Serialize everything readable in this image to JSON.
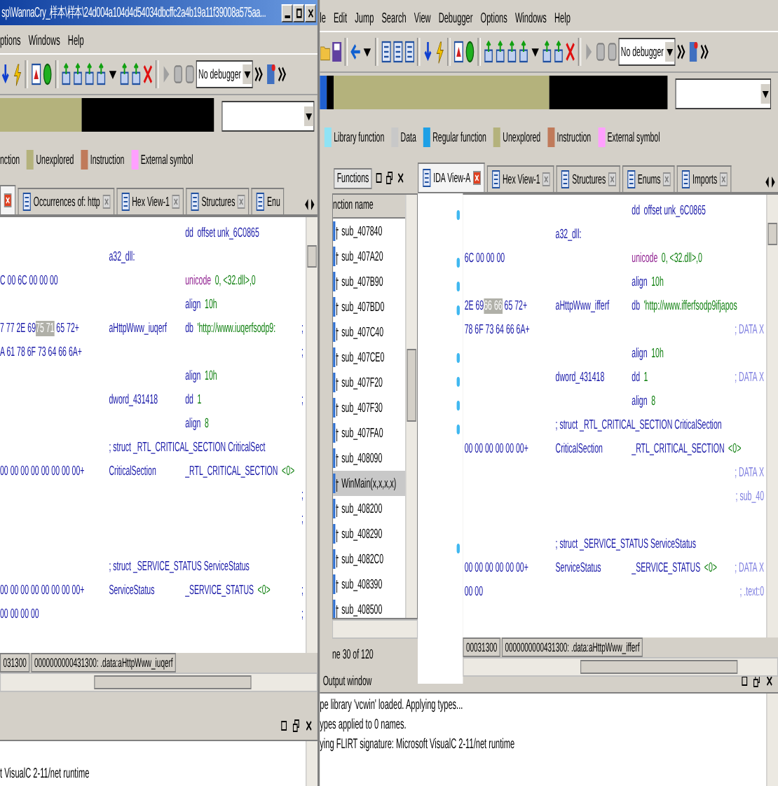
{
  "left_window": {
    "title": "sp\\WannaCry_样本\\样本\\24d004a104d4d54034dbcffc2a4b19a11f39008a575aa...",
    "menu": [
      "ptions",
      "Windows",
      "Help"
    ],
    "debugger": "No debugger",
    "legend": [
      {
        "label": "nction"
      },
      {
        "label": "Unexplored",
        "color": "#b4b27c"
      },
      {
        "label": "Instruction",
        "color": "#c07a5a"
      },
      {
        "label": "External symbol",
        "color": "#ffa0ff"
      }
    ],
    "tabs": [
      {
        "selected": true
      },
      {
        "label": "Occurrences of: http",
        "selected": false
      },
      {
        "label": "Hex View-1",
        "selected": false
      },
      {
        "label": "Structures",
        "selected": false
      },
      {
        "label": "Enu",
        "selected": false
      }
    ],
    "listing": [
      {
        "mnemonic": "dd",
        "operand": "offset unk_6C0865",
        "kind": "ref"
      },
      {
        "label": "a32_dll:",
        "kind": "plain"
      },
      {
        "bytes": "C 00 6C 00 00 00",
        "mnemonic": "unicode",
        "operand": "0, <32.dll>,0",
        "kind": "unicode"
      },
      {
        "mnemonic": "align",
        "operand": "10h",
        "kind": "data"
      },
      {
        "bytes": "7 77 2E 69",
        "bytes_hl": "75 71",
        "bytes_post": "65 72+",
        "label": "aHttpWww_iuqerf",
        "mnemonic": "db",
        "operand": "'http://www.iuqerfsodp9:",
        "comment": ";",
        "kind": "data"
      },
      {
        "bytes": "A 61 78 6F 73 64 66 6A+",
        "comment": ";",
        "kind": "plain"
      },
      {
        "mnemonic": "align",
        "operand": "10h",
        "kind": "data"
      },
      {
        "label": "dword_431418",
        "mnemonic": "dd",
        "operand": "1",
        "comment": ";",
        "kind": "data"
      },
      {
        "mnemonic": "align",
        "operand": "8",
        "kind": "data"
      },
      {
        "mnemonic": "; struct _RTL_CRITICAL_SECTION CriticalSect",
        "kind": "struct"
      },
      {
        "bytes": "00 00 00 00 00 00 00 00+",
        "label": "CriticalSection",
        "mnemonic": "_RTL_CRITICAL_SECTION",
        "operand": "<0>",
        "kind": "struct_var"
      },
      {
        "comment": ";",
        "kind": "plain"
      },
      {
        "comment": ";",
        "kind": "plain"
      },
      {
        "kind": "blank"
      },
      {
        "mnemonic": "; struct _SERVICE_STATUS ServiceStatus",
        "kind": "struct"
      },
      {
        "bytes": "00 00 00 00 00 00 00 00+",
        "label": "ServiceStatus",
        "mnemonic": "_SERVICE_STATUS",
        "operand": "<0>",
        "comment": ";",
        "kind": "struct_var"
      },
      {
        "bytes": "00 00 00 00",
        "comment": ";",
        "kind": "plain"
      }
    ],
    "status": [
      "031300",
      "0000000000431300: .data:aHttpWww_iuqerf"
    ],
    "output": [
      "t VisualC 2-11/net runtime"
    ]
  },
  "right_window": {
    "menu": [
      "le",
      "Edit",
      "Jump",
      "Search",
      "View",
      "Debugger",
      "Options",
      "Windows",
      "Help"
    ],
    "debugger": "No debugger",
    "legend": [
      {
        "label": "Library function",
        "color": "#8fe3f5"
      },
      {
        "label": "Data",
        "color": "#c8c8c8"
      },
      {
        "label": "Regular function",
        "color": "#1ea0e6"
      },
      {
        "label": "Unexplored",
        "color": "#b4b27c"
      },
      {
        "label": "Instruction",
        "color": "#c07a5a"
      },
      {
        "label": "External symbol",
        "color": "#ffa0ff"
      }
    ],
    "functions": {
      "title": "Functions",
      "column": "nction name",
      "items": [
        {
          "name": "sub_407840",
          "selected": false
        },
        {
          "name": "sub_407A20",
          "selected": false
        },
        {
          "name": "sub_407B90",
          "selected": false
        },
        {
          "name": "sub_407BD0",
          "selected": false
        },
        {
          "name": "sub_407C40",
          "selected": false
        },
        {
          "name": "sub_407CE0",
          "selected": false
        },
        {
          "name": "sub_407F20",
          "selected": false
        },
        {
          "name": "sub_407F30",
          "selected": false
        },
        {
          "name": "sub_407FA0",
          "selected": false
        },
        {
          "name": "sub_408090",
          "selected": false
        },
        {
          "name": "WinMain(x,x,x,x)",
          "selected": true
        },
        {
          "name": "sub_408200",
          "selected": false
        },
        {
          "name": "sub_408290",
          "selected": false
        },
        {
          "name": "sub_4082C0",
          "selected": false
        },
        {
          "name": "sub_408390",
          "selected": false
        },
        {
          "name": "sub_408500",
          "selected": false
        }
      ],
      "status": "ne 30 of 120"
    },
    "tabs": [
      {
        "label": "IDA View-A",
        "selected": true
      },
      {
        "label": "Hex View-1",
        "selected": false
      },
      {
        "label": "Structures",
        "selected": false
      },
      {
        "label": "Enums",
        "selected": false
      },
      {
        "label": "Imports",
        "selected": false
      }
    ],
    "listing": [
      {
        "mnemonic": "dd",
        "operand": "offset unk_6C0865",
        "kind": "ref"
      },
      {
        "label": "a32_dll:",
        "kind": "plain"
      },
      {
        "bytes": "6C 00 00 00",
        "mnemonic": "unicode",
        "operand": "0, <32.dll>,0",
        "kind": "unicode"
      },
      {
        "mnemonic": "align",
        "operand": "10h",
        "kind": "data"
      },
      {
        "bytes": "2E 69",
        "bytes_hl": "66 66",
        "bytes_post": "65 72+",
        "label": "aHttpWww_ifferf",
        "mnemonic": "db",
        "operand": "'http://www.ifferfsodp9ifjapos",
        "kind": "data"
      },
      {
        "bytes": "78 6F 73 64 66 6A+",
        "comment": "; DATA X",
        "kind": "plain"
      },
      {
        "mnemonic": "align",
        "operand": "10h",
        "kind": "data"
      },
      {
        "label": "dword_431418",
        "mnemonic": "dd",
        "operand": "1",
        "comment": "; DATA X",
        "kind": "data"
      },
      {
        "mnemonic": "align",
        "operand": "8",
        "kind": "data"
      },
      {
        "mnemonic": "; struct _RTL_CRITICAL_SECTION CriticalSection",
        "kind": "struct"
      },
      {
        "bytes": "00 00 00 00 00 00+",
        "label": "CriticalSection",
        "mnemonic": "_RTL_CRITICAL_SECTION",
        "operand": "<0>",
        "kind": "struct_var"
      },
      {
        "comment": "; DATA X",
        "kind": "plain"
      },
      {
        "comment": "; sub_40",
        "kind": "plain"
      },
      {
        "kind": "blank"
      },
      {
        "mnemonic": "; struct _SERVICE_STATUS ServiceStatus",
        "kind": "struct"
      },
      {
        "bytes": "00 00 00 00 00 00+",
        "label": "ServiceStatus",
        "mnemonic": "_SERVICE_STATUS",
        "operand": "<0>",
        "comment": "; DATA X",
        "kind": "struct_var"
      },
      {
        "bytes": "00 00",
        "comment": "; .text:0",
        "kind": "plain"
      }
    ],
    "status": [
      "00031300",
      "0000000000431300: .data:aHttpWww_ifferf"
    ],
    "output_window": {
      "title": "Output window",
      "lines": [
        "pe library 'vcwin' loaded. Applying types...",
        "ypes applied to 0 names.",
        "ying FLIRT signature: Microsoft VisualC 2-11/net runtime"
      ]
    }
  }
}
